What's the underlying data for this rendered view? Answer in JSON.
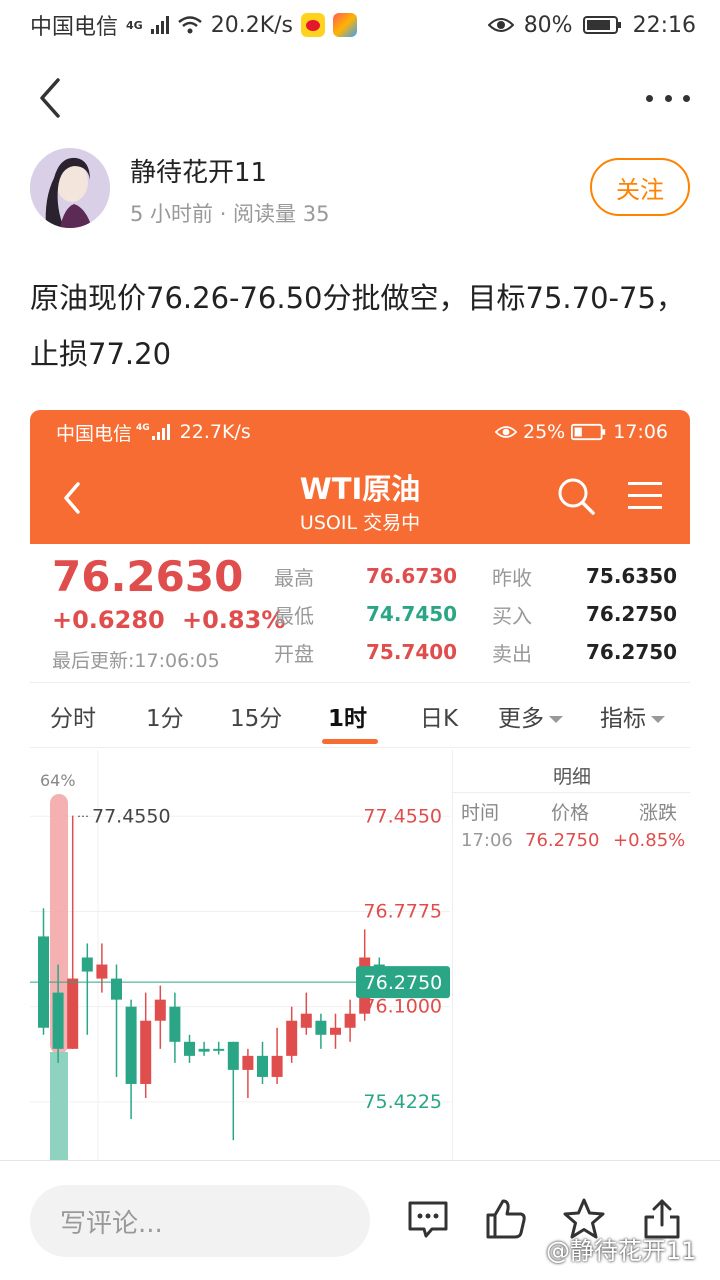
{
  "status_bar": {
    "carrier": "中国电信",
    "network": "4G",
    "speed": "20.2K/s",
    "battery": "80%",
    "time": "22:16"
  },
  "author": {
    "name": "静待花开11",
    "meta": "5 小时前 · 阅读量 35",
    "follow_label": "关注"
  },
  "post": {
    "text": "原油现价76.26-76.50分批做空，目标75.70-75，止损77.20"
  },
  "screenshot": {
    "status": {
      "carrier": "中国电信",
      "network": "4G",
      "speed": "22.7K/s",
      "battery": "25%",
      "time": "17:06"
    },
    "title": "WTI原油",
    "subtitle": "USOIL 交易中",
    "quote": {
      "price": "76.2630",
      "change": "+0.6280",
      "change_pct": "+0.83%",
      "updated": "最后更新:17:06:05",
      "high_label": "最高",
      "high": "76.6730",
      "low_label": "最低",
      "low": "74.7450",
      "open_label": "开盘",
      "open": "75.7400",
      "prev_label": "昨收",
      "prev": "75.6350",
      "bid_label": "买入",
      "bid": "76.2750",
      "ask_label": "卖出",
      "ask": "76.2750"
    },
    "tabs": [
      "分时",
      "1分",
      "15分",
      "1时",
      "日K",
      "更多",
      "指标"
    ],
    "active_tab": "1时",
    "detail": {
      "title": "明细",
      "headers": [
        "时间",
        "价格",
        "涨跌"
      ],
      "rows": [
        [
          "17:06",
          "76.2750",
          "+0.85%"
        ]
      ]
    },
    "colors": {
      "accent": "#f76c32",
      "up": "#e04d4d",
      "down": "#2aa686"
    }
  },
  "chart_data": {
    "type": "candlestick",
    "y_ticks": [
      "77.4550",
      "76.7775",
      "76.1000",
      "75.4225"
    ],
    "ylim": [
      75.08,
      77.82
    ],
    "current_price": "76.2750",
    "max_marker": "77.4550",
    "volume_label": "64%",
    "candles": [
      {
        "o": 76.6,
        "c": 75.95,
        "h": 76.8,
        "l": 75.9
      },
      {
        "o": 76.2,
        "c": 75.8,
        "h": 76.4,
        "l": 75.7
      },
      {
        "o": 75.8,
        "c": 76.3,
        "h": 77.46,
        "l": 75.8
      },
      {
        "o": 76.45,
        "c": 76.35,
        "h": 76.55,
        "l": 75.9
      },
      {
        "o": 76.3,
        "c": 76.4,
        "h": 76.55,
        "l": 76.2
      },
      {
        "o": 76.3,
        "c": 76.15,
        "h": 76.4,
        "l": 75.6
      },
      {
        "o": 76.1,
        "c": 75.55,
        "h": 76.15,
        "l": 75.3
      },
      {
        "o": 75.55,
        "c": 76.0,
        "h": 76.2,
        "l": 75.45
      },
      {
        "o": 76.0,
        "c": 76.15,
        "h": 76.25,
        "l": 75.8
      },
      {
        "o": 76.1,
        "c": 75.85,
        "h": 76.2,
        "l": 75.7
      },
      {
        "o": 75.85,
        "c": 75.75,
        "h": 75.9,
        "l": 75.7
      },
      {
        "o": 75.8,
        "c": 75.78,
        "h": 75.85,
        "l": 75.75
      },
      {
        "o": 75.8,
        "c": 75.79,
        "h": 75.85,
        "l": 75.76
      },
      {
        "o": 75.85,
        "c": 75.65,
        "h": 75.85,
        "l": 75.15
      },
      {
        "o": 75.65,
        "c": 75.75,
        "h": 75.8,
        "l": 75.45
      },
      {
        "o": 75.75,
        "c": 75.6,
        "h": 75.85,
        "l": 75.55
      },
      {
        "o": 75.6,
        "c": 75.75,
        "h": 75.95,
        "l": 75.55
      },
      {
        "o": 75.75,
        "c": 76.0,
        "h": 76.1,
        "l": 75.7
      },
      {
        "o": 75.95,
        "c": 76.05,
        "h": 76.2,
        "l": 75.9
      },
      {
        "o": 76.0,
        "c": 75.9,
        "h": 76.05,
        "l": 75.8
      },
      {
        "o": 75.9,
        "c": 75.95,
        "h": 76.05,
        "l": 75.8
      },
      {
        "o": 75.95,
        "c": 76.05,
        "h": 76.15,
        "l": 75.85
      },
      {
        "o": 76.05,
        "c": 76.45,
        "h": 76.65,
        "l": 76.0
      },
      {
        "o": 76.4,
        "c": 76.28,
        "h": 76.45,
        "l": 76.2
      }
    ]
  },
  "bottom_bar": {
    "comment_placeholder": "写评论...",
    "watermark": "@静待花开11"
  }
}
